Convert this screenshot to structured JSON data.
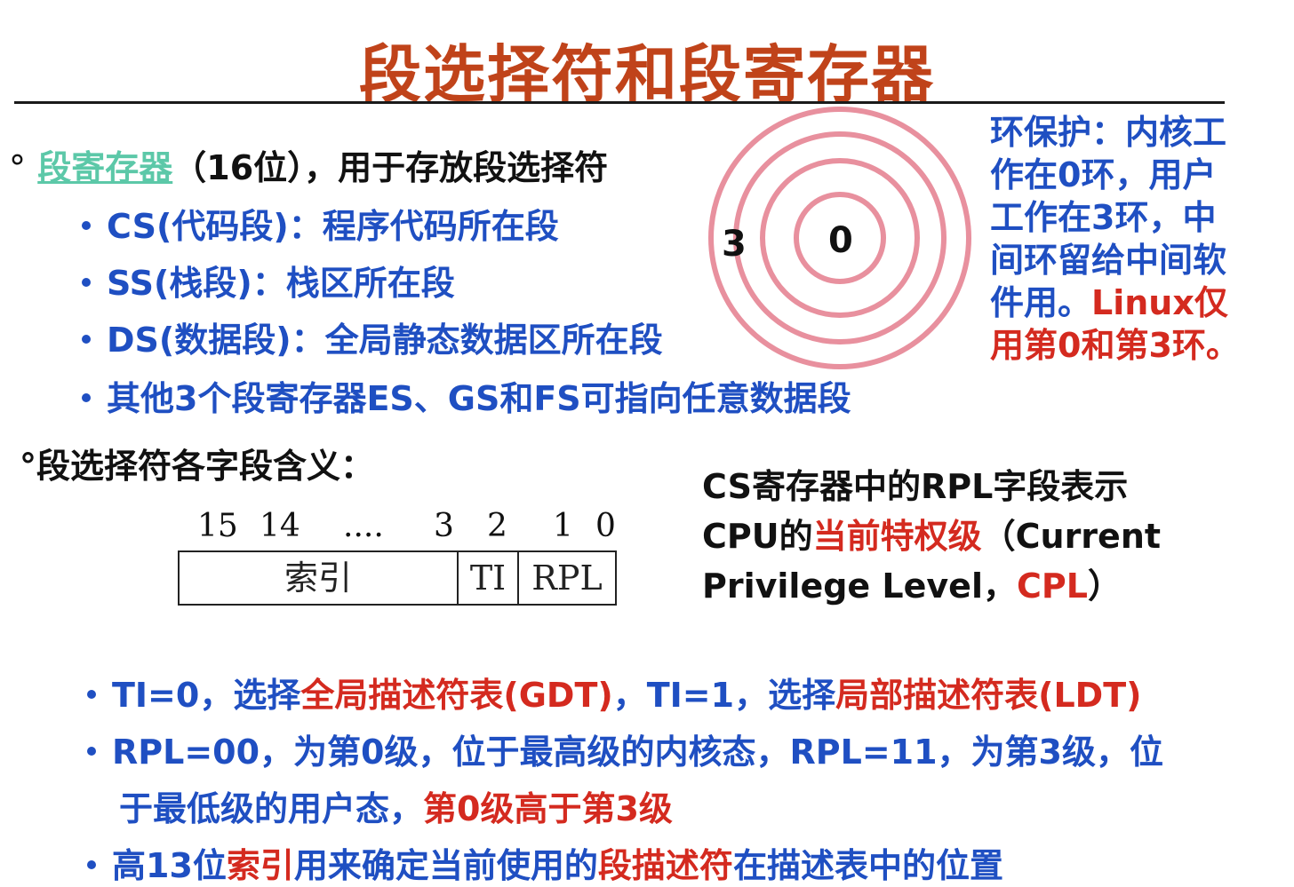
{
  "title": "段选择符和段寄存器",
  "bullet_marker": "°",
  "seg_reg": {
    "term": "段寄存器",
    "rest": "（16位），用于存放段选择符",
    "items": [
      "CS(代码段)：程序代码所在段",
      "SS(栈段)：栈区所在段",
      "DS(数据段)：全局静态数据区所在段",
      "其他3个段寄存器ES、GS和FS可指向任意数据段"
    ]
  },
  "rings": {
    "outer_label": "3",
    "inner_label": "0",
    "ring_color": "#e8909e"
  },
  "ring_note": {
    "blue_part": "环保护：内核工作在0环，用户工作在3环，中间环留给中间软件用。",
    "red_part": "Linux仅用第0和第3环。"
  },
  "selector_heading": "°段选择符各字段含义：",
  "bitfield": {
    "bits": [
      "15",
      "14",
      "....",
      "3",
      "2",
      "1",
      "0"
    ],
    "fields": [
      "索引",
      "TI",
      "RPL"
    ]
  },
  "cs_note": {
    "p1": "CS寄存器中的RPL字段表示CPU的",
    "red1": "当前特权级",
    "p2": "（Current Privilege Level，",
    "red2": "CPL",
    "p3": "）"
  },
  "bottom": [
    {
      "a": "TI=0，选择",
      "b": "全局描述符表(GDT)",
      "c": "，TI=1，选择",
      "d": "局部描述符表(LDT)"
    },
    {
      "line1": "RPL=00，为第0级，位于最高级的内核态，RPL=11，为第3级，位",
      "line2a": "于最低级的用户态，",
      "line2b": "第0级高于第3级"
    },
    {
      "a": "高13位",
      "b": "索引",
      "c": "用来确定当前使用的",
      "d": "段描述符",
      "e": "在描述表中的位置"
    }
  ],
  "colors": {
    "title": "#c0431a",
    "blue": "#1f4fc2",
    "red": "#d42a1f",
    "teal": "#5cc8a8"
  }
}
